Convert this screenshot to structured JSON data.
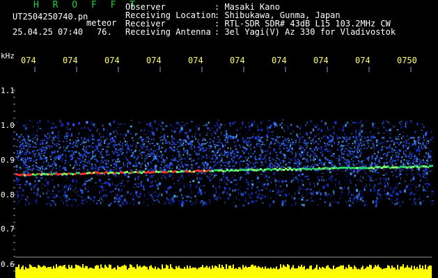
{
  "header": {
    "app_title": "H R O F F T",
    "filename": "UT2504250740.pn",
    "event_type": "meteor",
    "datetime": "25.04.25 07:40",
    "count": "76.",
    "info": [
      {
        "label": "Observer",
        "value": ": Masaki Kano"
      },
      {
        "label": "Receiving Location",
        "value": ": Shibukawa, Gunma, Japan"
      },
      {
        "label": "Receiver",
        "value": ": RTL-SDR SDR# 43dB L15 103.2MHz CW"
      },
      {
        "label": "Receiving Antenna",
        "value": ": 3el Yagi(V) Az 330 for Vladivostok"
      }
    ]
  },
  "spectrogram": {
    "unit_label": "kHz",
    "y_ticks": [
      "1.1",
      "1.0",
      "0.9",
      "0.8",
      "0.7",
      "0.6"
    ],
    "time_labels": [
      "074",
      "074",
      "074",
      "074",
      "074",
      "074",
      "074",
      "074",
      "074",
      "0750"
    ],
    "colors": {
      "time_label": "#ffff66",
      "tick_label": "#ffffff",
      "tick_line": "#8aa0c8",
      "background_noise": "#1e3cff",
      "carrier_line": "#2ad46a",
      "carrier_peak": "#ff3030",
      "level_bar": "#ffff00"
    }
  }
}
